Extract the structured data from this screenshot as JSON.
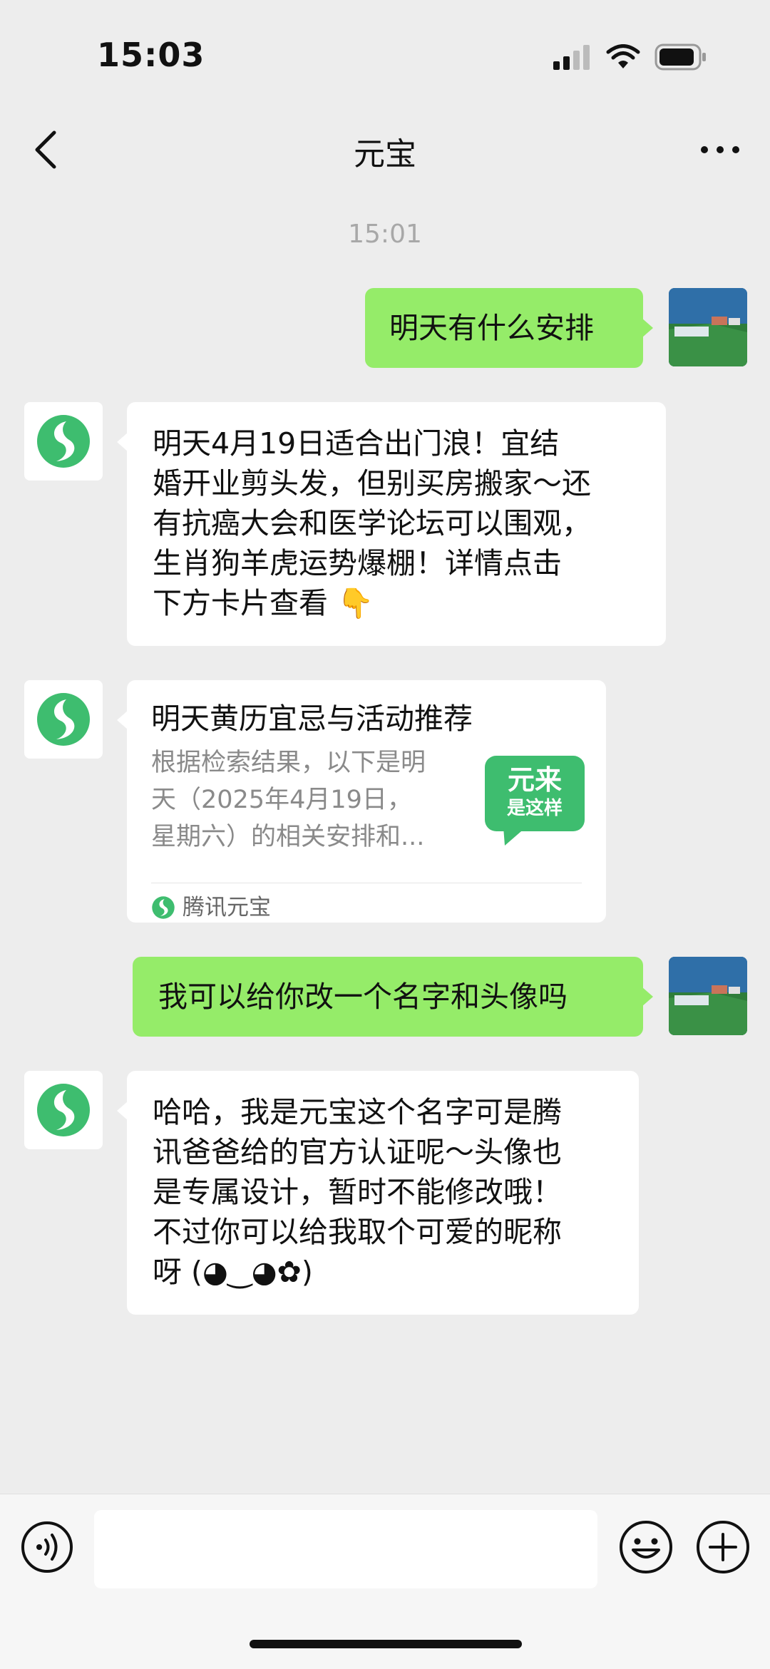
{
  "status": {
    "time": "15:03"
  },
  "nav": {
    "title": "元宝"
  },
  "chat": {
    "timestamp": "15:01",
    "messages": [
      {
        "text": "明天有什么安排"
      },
      {
        "text": "明天4月19日适合出门浪！宜结\n婚开业剪头发，但别买房搬家～还\n有抗癌大会和医学论坛可以围观，\n生肖狗羊虎运势爆棚！详情点击\n下方卡片查看 👇"
      },
      {
        "card_title": "明天黄历宜忌与活动推荐",
        "card_desc": "根据检索结果，以下是明\n天（2025年4月19日，\n星期六）的相关安排和...",
        "thumb_line1": "元来",
        "thumb_line2": "是这样",
        "source": "腾讯元宝"
      },
      {
        "text": "我可以给你改一个名字和头像吗"
      },
      {
        "text": "哈哈，我是元宝这个名字可是腾\n讯爸爸给的官方认证呢～头像也\n是专属设计，暂时不能修改哦！\n不过你可以给我取个可爱的昵称\n呀 (◕‿◕✿)"
      }
    ]
  },
  "input": {
    "value": ""
  },
  "icons": {
    "back": "chevron-left-icon",
    "more": "more-horizontal-icon",
    "voice": "voice-icon",
    "emoji": "emoji-icon",
    "plus": "plus-icon",
    "signal": "signal-icon",
    "wifi": "wifi-icon",
    "battery": "battery-icon",
    "yuanbao_logo": "yuanbao-logo-icon"
  },
  "colors": {
    "background": "#ededed",
    "sent_bubble": "#95ec69",
    "received_bubble": "#ffffff",
    "brand_green": "#3ebd6f",
    "timestamp": "#a8a8a8"
  }
}
